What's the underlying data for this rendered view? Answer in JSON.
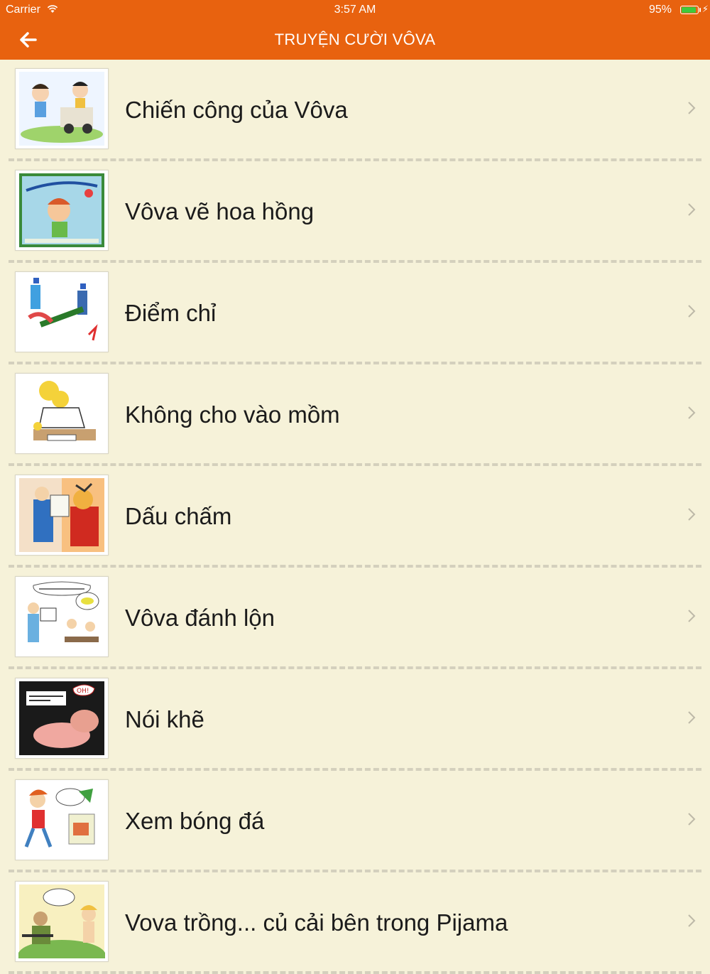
{
  "status_bar": {
    "carrier": "Carrier",
    "time": "3:57 AM",
    "battery": "95%",
    "battery_level": 0.95
  },
  "nav": {
    "title": "TRUYỆN CƯỜI VÔVA"
  },
  "stories": [
    {
      "title": "Chiến công của Vôva"
    },
    {
      "title": "Vôva vẽ hoa hồng"
    },
    {
      "title": "Điểm chỉ"
    },
    {
      "title": "Không cho vào mồm"
    },
    {
      "title": "Dấu chấm"
    },
    {
      "title": "Vôva đánh lộn"
    },
    {
      "title": "Nói khẽ"
    },
    {
      "title": "Xem bóng đá"
    },
    {
      "title": "Vova trồng... củ cải bên trong Pijama"
    }
  ],
  "colors": {
    "accent": "#e8620f",
    "background": "#f6f2d9"
  }
}
